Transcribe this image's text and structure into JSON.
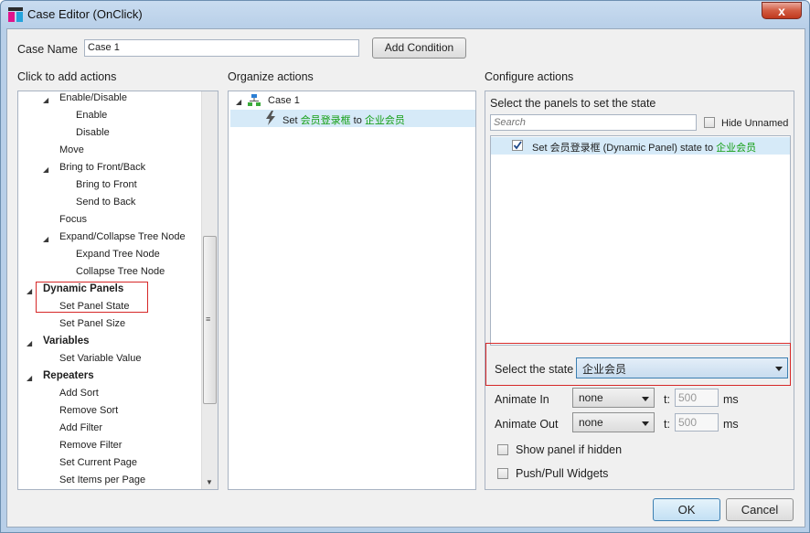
{
  "window": {
    "title": "Case Editor (OnClick)",
    "close_glyph": "x"
  },
  "case_name": {
    "label": "Case Name",
    "value": "Case 1",
    "add_condition_label": "Add Condition"
  },
  "left": {
    "heading": "Click to add actions",
    "items": [
      {
        "label": "Enable/Disable",
        "level": 1,
        "expander": true
      },
      {
        "label": "Enable",
        "level": 2
      },
      {
        "label": "Disable",
        "level": 2
      },
      {
        "label": "Move",
        "level": 1
      },
      {
        "label": "Bring to Front/Back",
        "level": 1,
        "expander": true
      },
      {
        "label": "Bring to Front",
        "level": 2
      },
      {
        "label": "Send to Back",
        "level": 2
      },
      {
        "label": "Focus",
        "level": 1
      },
      {
        "label": "Expand/Collapse Tree Node",
        "level": 1,
        "expander": true
      },
      {
        "label": "Expand Tree Node",
        "level": 2
      },
      {
        "label": "Collapse Tree Node",
        "level": 2
      },
      {
        "label": "Dynamic Panels",
        "level": 0,
        "expander": true,
        "bold": true
      },
      {
        "label": "Set Panel State",
        "level": 1
      },
      {
        "label": "Set Panel Size",
        "level": 1
      },
      {
        "label": "Variables",
        "level": 0,
        "expander": true,
        "bold": true
      },
      {
        "label": "Set Variable Value",
        "level": 1
      },
      {
        "label": "Repeaters",
        "level": 0,
        "expander": true,
        "bold": true
      },
      {
        "label": "Add Sort",
        "level": 1
      },
      {
        "label": "Remove Sort",
        "level": 1
      },
      {
        "label": "Add Filter",
        "level": 1
      },
      {
        "label": "Remove Filter",
        "level": 1
      },
      {
        "label": "Set Current Page",
        "level": 1
      },
      {
        "label": "Set Items per Page",
        "level": 1
      }
    ]
  },
  "middle": {
    "heading": "Organize actions",
    "case_label": "Case 1",
    "action_prefix": "Set ",
    "action_panel": "会员登录框",
    "action_to": " to ",
    "action_state": "企业会员"
  },
  "right": {
    "heading": "Configure actions",
    "subheading": "Select the panels to set the state",
    "search_placeholder": "Search",
    "hide_unnamed_label": "Hide Unnamed",
    "panel_row_prefix": "Set 会员登录框 (Dynamic Panel) state to ",
    "panel_row_state": "企业会员",
    "select_state_label": "Select the state",
    "select_state_value": "企业会员",
    "animate_in_label": "Animate In",
    "animate_in_value": "none",
    "animate_in_t": "t:",
    "animate_in_ms_value": "500",
    "animate_in_ms": "ms",
    "animate_out_label": "Animate Out",
    "animate_out_value": "none",
    "animate_out_t": "t:",
    "animate_out_ms_value": "500",
    "animate_out_ms": "ms",
    "show_if_hidden_label": "Show panel if hidden",
    "push_pull_label": "Push/Pull Widgets"
  },
  "footer": {
    "ok_label": "OK",
    "cancel_label": "Cancel"
  },
  "colors": {
    "highlight_row": "#d6eaf8",
    "green_text": "#129e12",
    "red_box": "#d62828"
  }
}
